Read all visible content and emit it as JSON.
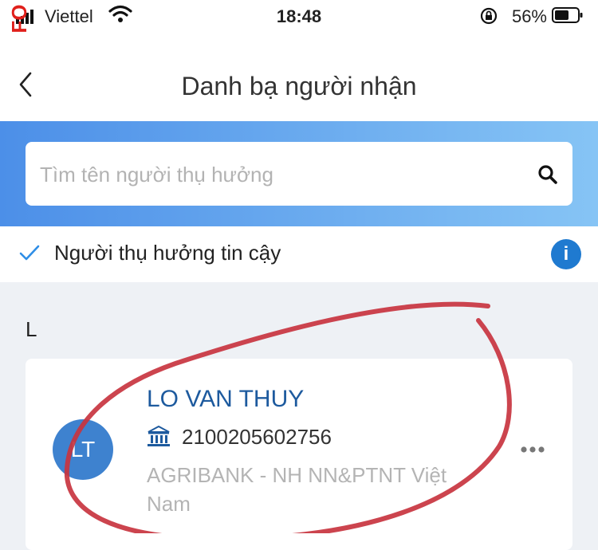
{
  "status_bar": {
    "carrier": "Viettel",
    "time": "18:48",
    "battery_percent": "56%"
  },
  "watermark": {
    "text": "M.INFO"
  },
  "header": {
    "title": "Danh bạ người nhận"
  },
  "search": {
    "placeholder": "Tìm tên người thụ hưởng"
  },
  "trusted_filter": {
    "label": "Người thụ hưởng tin cậy",
    "info_label": "i"
  },
  "sections": [
    {
      "letter": "L",
      "contacts": [
        {
          "initials": "LT",
          "name": "LO VAN THUY",
          "account_number": "2100205602756",
          "bank": "AGRIBANK - NH NN&PTNT Việt Nam"
        }
      ]
    }
  ],
  "colors": {
    "accent": "#1f7ad0",
    "name_blue": "#1d5a9e",
    "avatar": "#3e82cf",
    "annotation_red": "#c8343f",
    "watermark_red": "#e0201b"
  },
  "icons": [
    "signal-icon",
    "wifi-icon",
    "rotation-lock-icon",
    "battery-icon",
    "back-chevron-icon",
    "search-icon",
    "checkmark-icon",
    "info-icon",
    "bank-icon",
    "more-options-icon"
  ]
}
